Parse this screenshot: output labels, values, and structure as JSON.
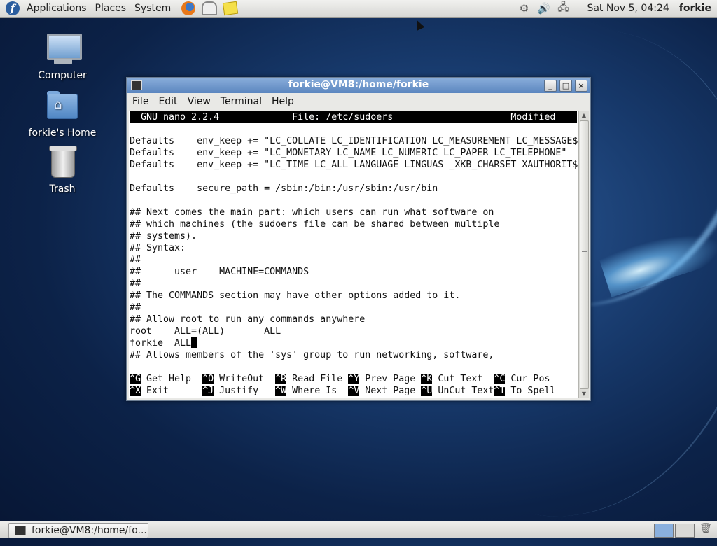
{
  "top_panel": {
    "menus": [
      "Applications",
      "Places",
      "System"
    ],
    "clock": "Sat Nov  5, 04:24",
    "username": "forkie"
  },
  "desktop_icons": [
    {
      "label": "Computer"
    },
    {
      "label": "forkie's Home"
    },
    {
      "label": "Trash"
    }
  ],
  "window": {
    "title": "forkie@VM8:/home/forkie",
    "menus": [
      "File",
      "Edit",
      "View",
      "Terminal",
      "Help"
    ],
    "controls": {
      "minimize": "_",
      "maximize": "□",
      "close": "×"
    }
  },
  "nano": {
    "header": "  GNU nano 2.2.4             File: /etc/sudoers                     Modified",
    "lines": [
      "",
      "Defaults    env_keep += \"LC_COLLATE LC_IDENTIFICATION LC_MEASUREMENT LC_MESSAGE$",
      "Defaults    env_keep += \"LC_MONETARY LC_NAME LC_NUMERIC LC_PAPER LC_TELEPHONE\"",
      "Defaults    env_keep += \"LC_TIME LC_ALL LANGUAGE LINGUAS _XKB_CHARSET XAUTHORIT$",
      "",
      "Defaults    secure_path = /sbin:/bin:/usr/sbin:/usr/bin",
      "",
      "## Next comes the main part: which users can run what software on",
      "## which machines (the sudoers file can be shared between multiple",
      "## systems).",
      "## Syntax:",
      "##",
      "##      user    MACHINE=COMMANDS",
      "##",
      "## The COMMANDS section may have other options added to it.",
      "##",
      "## Allow root to run any commands anywhere",
      "root    ALL=(ALL)       ALL",
      "forkie  ALL",
      "## Allows members of the 'sys' group to run networking, software,"
    ],
    "shortcuts_row1": [
      {
        "key": "^G",
        "label": " Get Help  "
      },
      {
        "key": "^O",
        "label": " WriteOut  "
      },
      {
        "key": "^R",
        "label": " Read File "
      },
      {
        "key": "^Y",
        "label": " Prev Page "
      },
      {
        "key": "^K",
        "label": " Cut Text  "
      },
      {
        "key": "^C",
        "label": " Cur Pos"
      }
    ],
    "shortcuts_row2": [
      {
        "key": "^X",
        "label": " Exit      "
      },
      {
        "key": "^J",
        "label": " Justify   "
      },
      {
        "key": "^W",
        "label": " Where Is  "
      },
      {
        "key": "^V",
        "label": " Next Page "
      },
      {
        "key": "^U",
        "label": " UnCut Text"
      },
      {
        "key": "^T",
        "label": " To Spell"
      }
    ]
  },
  "bottom_panel": {
    "task_label": "forkie@VM8:/home/fo..."
  }
}
